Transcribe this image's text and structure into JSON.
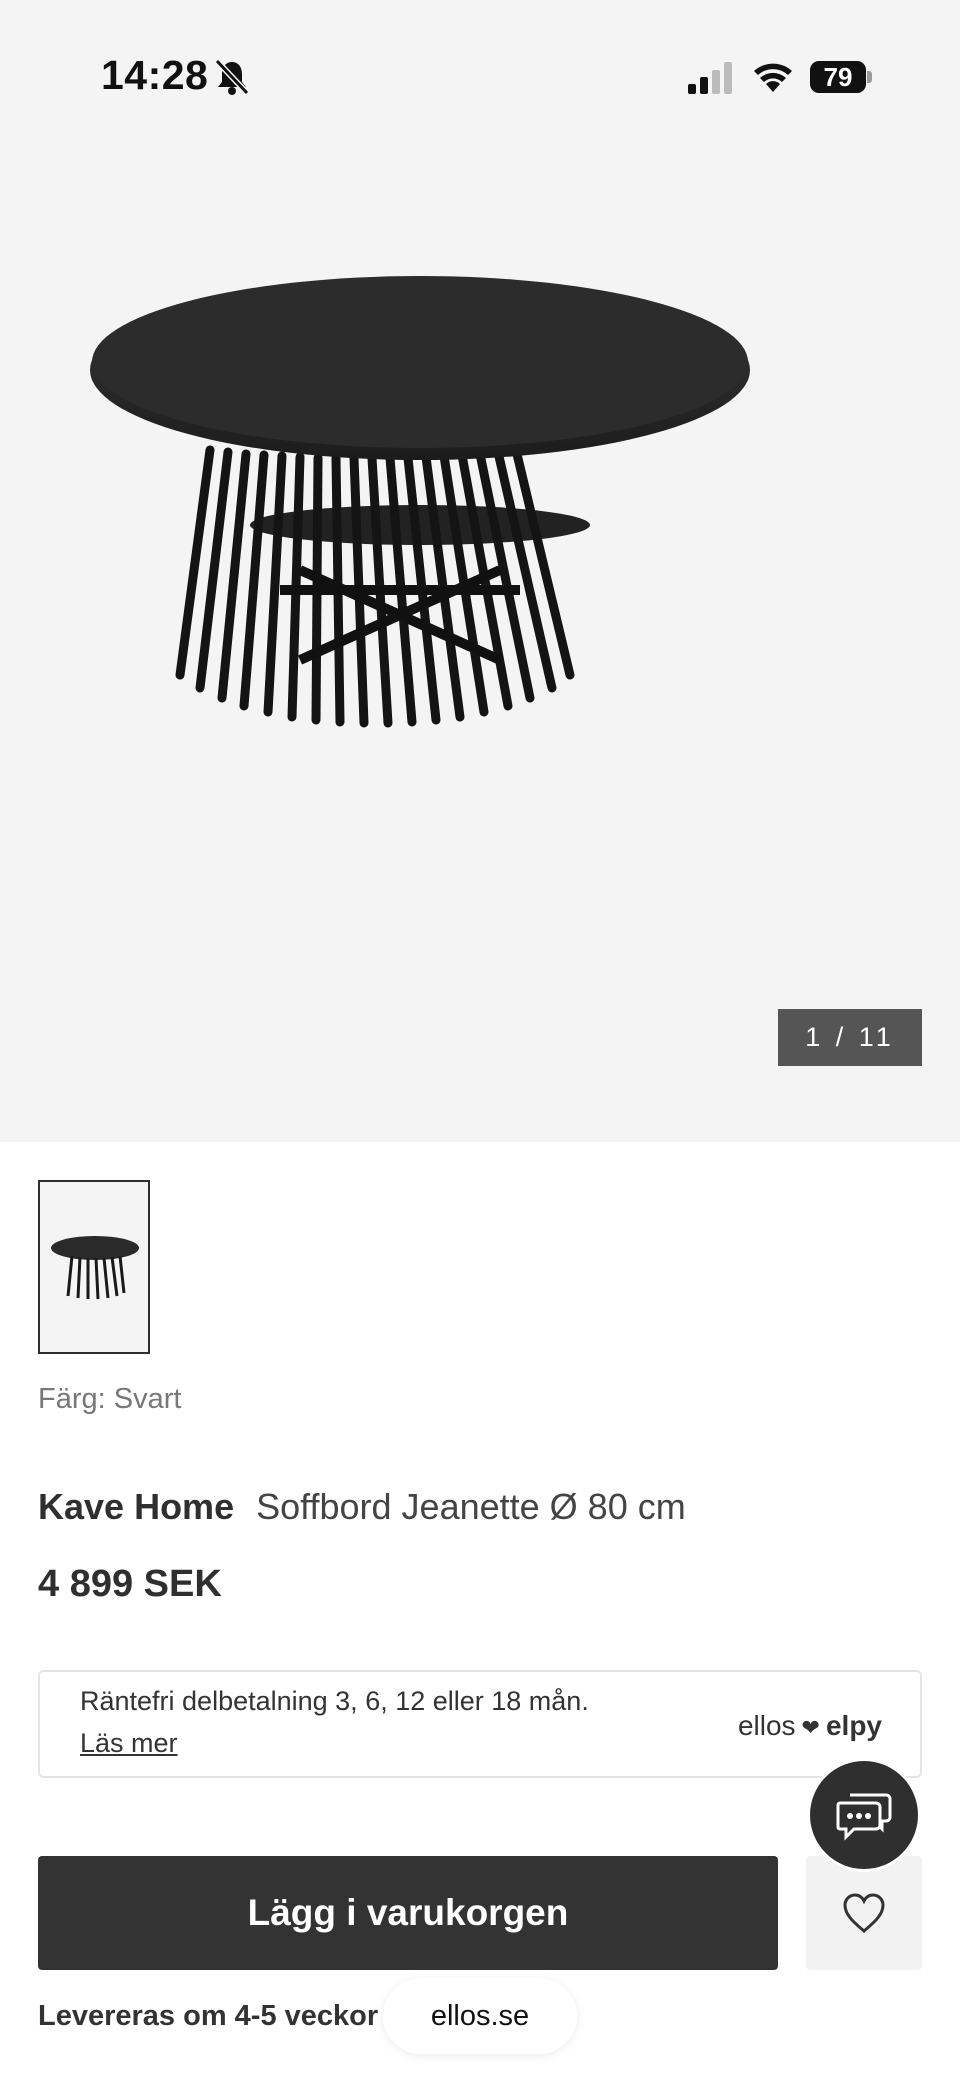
{
  "status_bar": {
    "time": "14:28",
    "battery": "79"
  },
  "gallery": {
    "counter": "1 / 11"
  },
  "product": {
    "color_label": "Färg: Svart",
    "brand": "Kave Home",
    "name": "Soffbord Jeanette Ø 80 cm",
    "price": "4 899 SEK"
  },
  "payment": {
    "text": "Räntefri delbetalning 3, 6, 12 eller 18 mån.",
    "link": "Läs mer",
    "partner_left": "ellos",
    "partner_right": "elpy"
  },
  "actions": {
    "add_to_cart": "Lägg i varukorgen"
  },
  "delivery": "Levereras om 4-5 veckor",
  "browser": {
    "url": "ellos.se"
  }
}
